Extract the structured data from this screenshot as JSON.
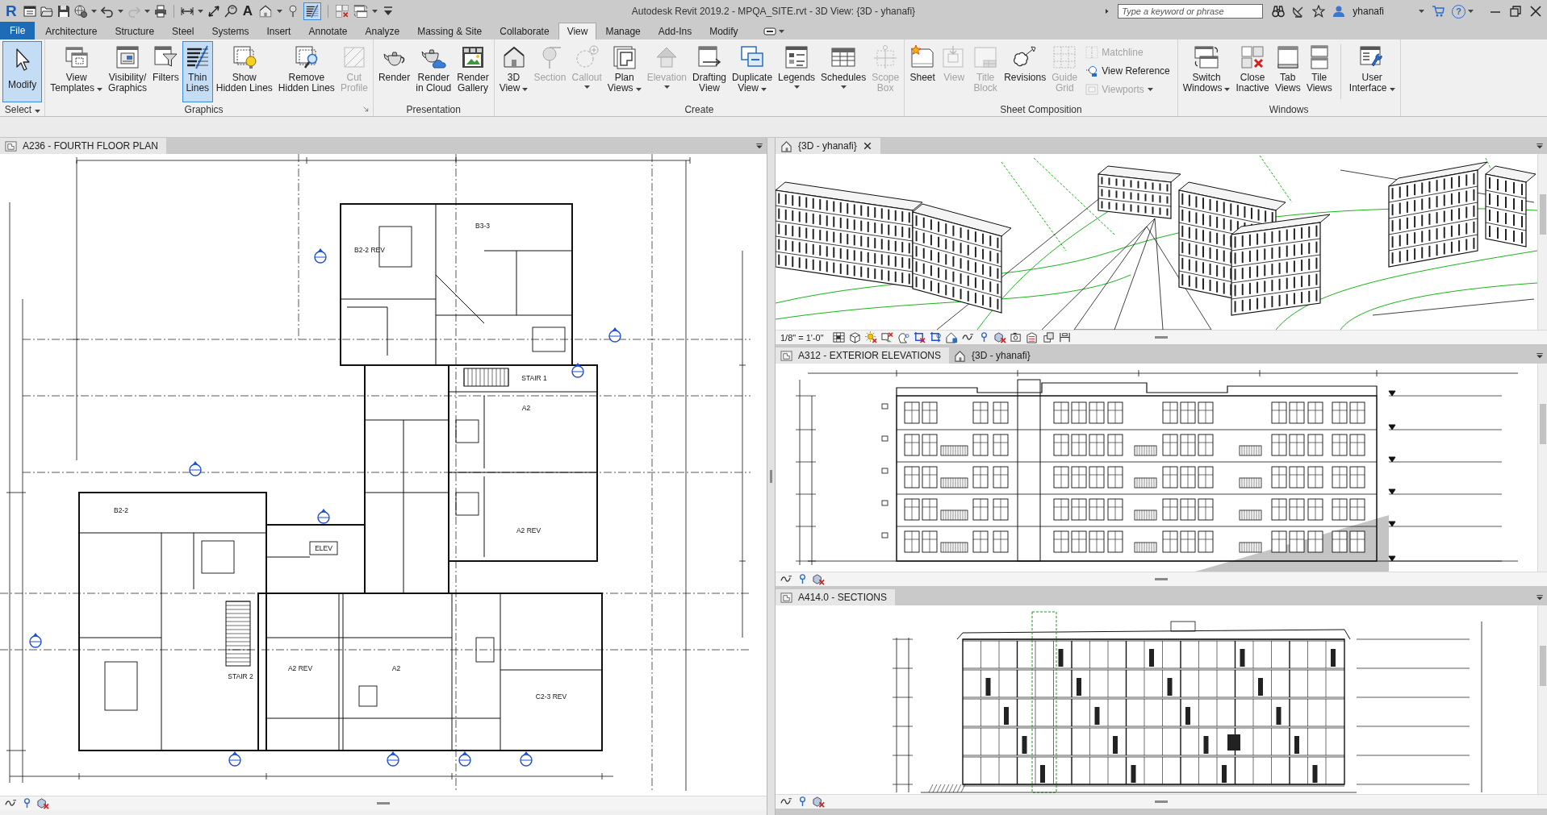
{
  "window": {
    "app_logo": "R",
    "title": "Autodesk Revit 2019.2 - MPQA_SITE.rvt - 3D View: {3D - yhanafi}",
    "search": {
      "placeholder": "Type a keyword or phrase"
    },
    "user": "yhanafi",
    "help_glyph": "?"
  },
  "quick_access": {
    "text_glyph": "A",
    "redo_disabled": true,
    "thin_lines_selected": true
  },
  "ribbon_tabs": [
    {
      "label": "File",
      "kind": "file",
      "selected": false
    },
    {
      "label": "Architecture",
      "kind": "tab",
      "selected": false
    },
    {
      "label": "Structure",
      "kind": "tab",
      "selected": false
    },
    {
      "label": "Steel",
      "kind": "tab",
      "selected": false
    },
    {
      "label": "Systems",
      "kind": "tab",
      "selected": false
    },
    {
      "label": "Insert",
      "kind": "tab",
      "selected": false
    },
    {
      "label": "Annotate",
      "kind": "tab",
      "selected": false
    },
    {
      "label": "Analyze",
      "kind": "tab",
      "selected": false
    },
    {
      "label": "Massing & Site",
      "kind": "tab",
      "selected": false
    },
    {
      "label": "Collaborate",
      "kind": "tab",
      "selected": false
    },
    {
      "label": "View",
      "kind": "tab",
      "selected": true
    },
    {
      "label": "Manage",
      "kind": "tab",
      "selected": false
    },
    {
      "label": "Add-Ins",
      "kind": "tab",
      "selected": false
    },
    {
      "label": "Modify",
      "kind": "tab",
      "selected": false
    }
  ],
  "ribbon": {
    "panels": [
      {
        "title": "Select",
        "dropdown": true,
        "launcher": false,
        "buttons": [
          {
            "kind": "large",
            "lines": [
              "Modify"
            ],
            "dropdown": false,
            "disabled": false,
            "selected": true
          }
        ]
      },
      {
        "title": "Graphics",
        "dropdown": false,
        "launcher": true,
        "buttons": [
          {
            "kind": "large",
            "lines": [
              "View",
              "Templates"
            ],
            "dropdown": true,
            "disabled": false,
            "selected": false
          },
          {
            "kind": "large",
            "lines": [
              "Visibility/",
              "Graphics"
            ],
            "dropdown": false,
            "disabled": false,
            "selected": false
          },
          {
            "kind": "large",
            "lines": [
              "Filters"
            ],
            "dropdown": false,
            "disabled": false,
            "selected": false
          },
          {
            "kind": "large",
            "lines": [
              "Thin",
              "Lines"
            ],
            "dropdown": false,
            "disabled": false,
            "selected": true
          },
          {
            "kind": "large",
            "lines": [
              "Show",
              "Hidden Lines"
            ],
            "dropdown": false,
            "disabled": false,
            "selected": false
          },
          {
            "kind": "large",
            "lines": [
              "Remove",
              "Hidden Lines"
            ],
            "dropdown": false,
            "disabled": false,
            "selected": false
          },
          {
            "kind": "large",
            "lines": [
              "Cut",
              "Profile"
            ],
            "dropdown": false,
            "disabled": true,
            "selected": false
          }
        ]
      },
      {
        "title": "Presentation",
        "dropdown": false,
        "launcher": false,
        "buttons": [
          {
            "kind": "large",
            "lines": [
              "Render"
            ],
            "dropdown": false,
            "disabled": false,
            "selected": false
          },
          {
            "kind": "large",
            "lines": [
              "Render",
              "in Cloud"
            ],
            "dropdown": false,
            "disabled": false,
            "selected": false
          },
          {
            "kind": "large",
            "lines": [
              "Render",
              "Gallery"
            ],
            "dropdown": false,
            "disabled": false,
            "selected": false
          }
        ]
      },
      {
        "title": "Create",
        "dropdown": false,
        "launcher": false,
        "buttons": [
          {
            "kind": "large",
            "lines": [
              "3D",
              "View"
            ],
            "dropdown": true,
            "disabled": false,
            "selected": false
          },
          {
            "kind": "large",
            "lines": [
              "Section"
            ],
            "dropdown": false,
            "disabled": true,
            "selected": false
          },
          {
            "kind": "large",
            "lines": [
              "Callout"
            ],
            "dropdown": true,
            "disabled": true,
            "selected": false
          },
          {
            "kind": "large",
            "lines": [
              "Plan",
              "Views"
            ],
            "dropdown": true,
            "disabled": false,
            "selected": false
          },
          {
            "kind": "large",
            "lines": [
              "Elevation"
            ],
            "dropdown": true,
            "disabled": true,
            "selected": false
          },
          {
            "kind": "large",
            "lines": [
              "Drafting",
              "View"
            ],
            "dropdown": false,
            "disabled": false,
            "selected": false
          },
          {
            "kind": "large",
            "lines": [
              "Duplicate",
              "View"
            ],
            "dropdown": true,
            "disabled": false,
            "selected": false
          },
          {
            "kind": "large",
            "lines": [
              "Legends"
            ],
            "dropdown": true,
            "disabled": false,
            "selected": false
          },
          {
            "kind": "large",
            "lines": [
              "Schedules"
            ],
            "dropdown": true,
            "disabled": false,
            "selected": false
          },
          {
            "kind": "large",
            "lines": [
              "Scope",
              "Box"
            ],
            "dropdown": false,
            "disabled": true,
            "selected": false
          }
        ]
      },
      {
        "title": "Sheet Composition",
        "dropdown": false,
        "launcher": false,
        "buttons": [
          {
            "kind": "large",
            "lines": [
              "Sheet"
            ],
            "dropdown": false,
            "disabled": false,
            "selected": false
          },
          {
            "kind": "large",
            "lines": [
              "View"
            ],
            "dropdown": false,
            "disabled": true,
            "selected": false
          },
          {
            "kind": "large",
            "lines": [
              "Title",
              "Block"
            ],
            "dropdown": false,
            "disabled": true,
            "selected": false
          },
          {
            "kind": "large",
            "lines": [
              "Revisions"
            ],
            "dropdown": false,
            "disabled": false,
            "selected": false
          },
          {
            "kind": "large",
            "lines": [
              "Guide",
              "Grid"
            ],
            "dropdown": false,
            "disabled": true,
            "selected": false
          },
          {
            "kind": "small",
            "lines": [
              "Matchline"
            ],
            "dropdown": false,
            "disabled": true,
            "selected": false
          },
          {
            "kind": "small",
            "lines": [
              "View Reference"
            ],
            "dropdown": false,
            "disabled": false,
            "selected": false
          },
          {
            "kind": "small",
            "lines": [
              "Viewports"
            ],
            "dropdown": true,
            "disabled": true,
            "selected": false
          }
        ]
      },
      {
        "title": "Windows",
        "dropdown": false,
        "launcher": false,
        "buttons": [
          {
            "kind": "large",
            "lines": [
              "Switch",
              "Windows"
            ],
            "dropdown": true,
            "disabled": false,
            "selected": false
          },
          {
            "kind": "large",
            "lines": [
              "Close",
              "Inactive"
            ],
            "dropdown": false,
            "disabled": false,
            "selected": false
          },
          {
            "kind": "large",
            "lines": [
              "Tab",
              "Views"
            ],
            "dropdown": false,
            "disabled": false,
            "selected": false
          },
          {
            "kind": "large",
            "lines": [
              "Tile",
              "Views"
            ],
            "dropdown": false,
            "disabled": false,
            "selected": false
          },
          {
            "kind": "large",
            "lines": [
              "User",
              "Interface"
            ],
            "dropdown": true,
            "disabled": false,
            "selected": false
          }
        ]
      }
    ]
  },
  "views": [
    {
      "kind": "plan",
      "tabs": [
        {
          "title": "A236 - FOURTH FLOOR PLAN",
          "kind": "sheet",
          "selected": true,
          "closable": false
        }
      ],
      "rooms": [
        "B2-2 REV",
        "B3-3",
        "STAIR 1",
        "A2",
        "A2 REV",
        "B2-2",
        "ELEV",
        "A2 REV",
        "A2",
        "STAIR 2",
        "C2-3 REV"
      ],
      "control_bar": {
        "kind": "compact"
      }
    },
    {
      "kind": "isometric",
      "tabs": [
        {
          "title": "{3D - yhanafi}",
          "kind": "model",
          "selected": true,
          "closable": true
        }
      ],
      "control_bar": {
        "kind": "full",
        "scale": "1/8\" = 1'-0\""
      }
    },
    {
      "kind": "elevation",
      "tabs": [
        {
          "title": "A312 - EXTERIOR ELEVATIONS",
          "kind": "sheet",
          "selected": true,
          "closable": false
        },
        {
          "title": "{3D - yhanafi}",
          "kind": "model",
          "selected": false,
          "closable": false
        }
      ],
      "control_bar": {
        "kind": "compact"
      }
    },
    {
      "kind": "section",
      "tabs": [
        {
          "title": "A414.0 - SECTIONS",
          "kind": "sheet",
          "selected": true,
          "closable": false
        }
      ],
      "control_bar": {
        "kind": "compact"
      }
    }
  ]
}
